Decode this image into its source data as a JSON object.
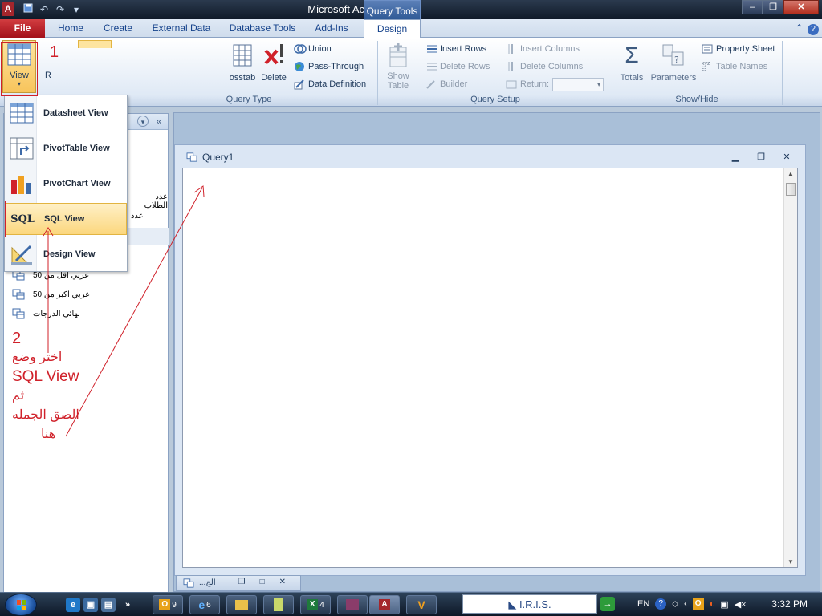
{
  "window": {
    "title": "Microsoft Access",
    "context_tab": "Query Tools"
  },
  "quick_access": [
    "save",
    "undo",
    "redo",
    "customize"
  ],
  "ribbon_tabs": [
    "File",
    "Home",
    "Create",
    "External Data",
    "Database Tools",
    "Add-Ins",
    "Design"
  ],
  "ribbon": {
    "view_label": "View",
    "results_clip": "R",
    "crosstab_clip": "osstab",
    "delete_label": "Delete",
    "union_label": "Union",
    "pass_through_label": "Pass-Through",
    "data_definition_label": "Data Definition",
    "query_type_label": "Query Type",
    "show_table_label_1": "Show",
    "show_table_label_2": "Table",
    "insert_rows": "Insert Rows",
    "delete_rows": "Delete Rows",
    "builder": "Builder",
    "insert_columns": "Insert Columns",
    "delete_columns": "Delete Columns",
    "return_label": "Return:",
    "query_setup_label": "Query Setup",
    "totals_label": "Totals",
    "parameters_label": "Parameters",
    "property_sheet": "Property Sheet",
    "table_names": "Table Names",
    "show_hide_label": "Show/Hide"
  },
  "view_menu": [
    {
      "label": "Datasheet View",
      "icon": "datasheet-icon"
    },
    {
      "label": "PivotTable View",
      "icon": "pivottable-icon"
    },
    {
      "label": "PivotChart View",
      "icon": "pivotchart-icon"
    },
    {
      "label": "SQL View",
      "icon": "sql-icon",
      "highlighted": true
    },
    {
      "label": "Design View",
      "icon": "design-icon"
    }
  ],
  "nav_pane": {
    "clipped_items": [
      "عدد الطلاب",
      "عدد"
    ],
    "items": [
      {
        "label": "عربي اقل من 50"
      },
      {
        "label": "عربي اكبر من 50"
      },
      {
        "label": "نهائي الدرجات"
      }
    ]
  },
  "query_window": {
    "title": "Query1",
    "minimized_title": "...الج"
  },
  "annotations": {
    "step1": "1",
    "step2": "2",
    "line1": "اختر وضع",
    "line2": "SQL View",
    "line3": "ثم",
    "line4": "الصق الجمله",
    "line5": "هنا"
  },
  "taskbar": {
    "outlook_count": "9",
    "ie_count": "6",
    "excel_count": "4",
    "search_text": "I.R.I.S.",
    "language": "EN",
    "time": "3:32 PM"
  },
  "colors": {
    "annotation_red": "#d0212a",
    "file_tab": "#b8141f",
    "menu_highlight": "#fbd77e"
  }
}
